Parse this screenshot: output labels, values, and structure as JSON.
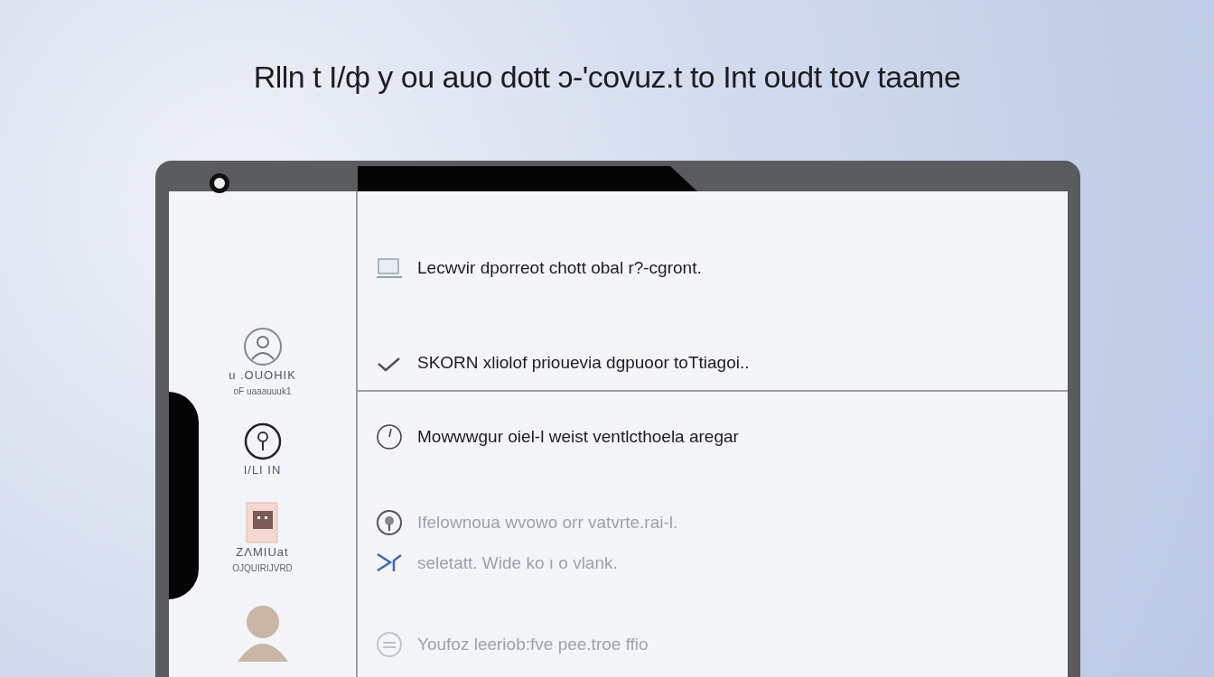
{
  "headline": "Rlln t I/ф y ou auo dott ɔ-'covuz.t to Int oudt tov taame",
  "sidebar": {
    "items": [
      {
        "kind": "avatar",
        "label": "u .OUOHIK",
        "sublabel": "oF uaaauuuk1"
      },
      {
        "kind": "pin",
        "label": "I/LI IN"
      },
      {
        "kind": "card",
        "label": "ZɅMIUat",
        "sublabel": "OJQUIRIJVRD"
      },
      {
        "kind": "person"
      }
    ]
  },
  "sections": [
    {
      "rows": [
        {
          "kind": "laptop",
          "text": "Lecwvir dporreot chott obal r?-cgront.",
          "dimmed": false
        },
        {
          "kind": "check",
          "text": "SKORN xliolof priouevia dgpuoor toTtiagoi..",
          "dimmed": false
        }
      ]
    },
    {
      "rows": [
        {
          "kind": "clock",
          "text": "Mowwwgur oiel-l weist ventlcthoela aregar",
          "dimmed": false
        },
        {
          "kind": "pin",
          "text": "Ifelownoua wvowo orr vatvrte.rai-l.",
          "dimmed": true
        },
        {
          "kind": "cross",
          "text": "seletatt. Wide ko ı o vlank.",
          "dimmed": true
        },
        {
          "kind": "lines",
          "text": "Youfoz leeriob:fve pee.troe ffio",
          "dimmed": true
        }
      ]
    }
  ]
}
